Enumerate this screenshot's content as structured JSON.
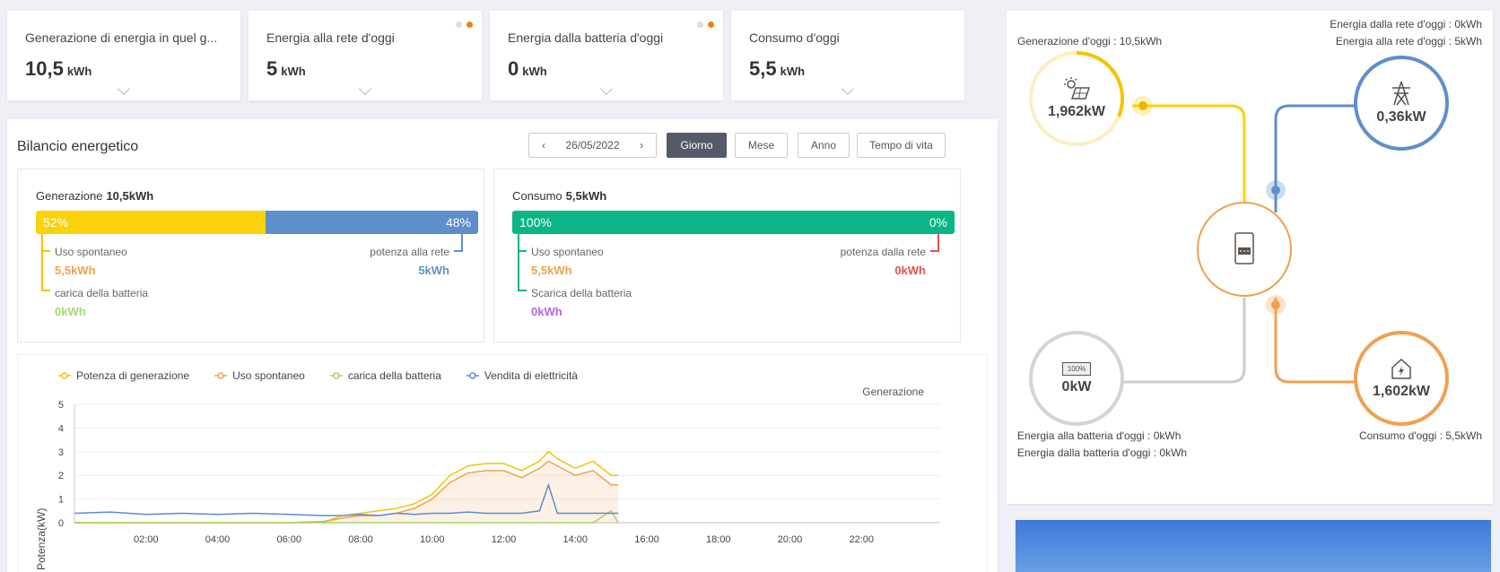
{
  "kpis": [
    {
      "title": "Generazione di energia in quel g...",
      "value": "10,5",
      "unit": "kWh",
      "dots": false
    },
    {
      "title": "Energia alla rete d'oggi",
      "value": "5",
      "unit": "kWh",
      "dots": true
    },
    {
      "title": "Energia dalla batteria d'oggi",
      "value": "0",
      "unit": "kWh",
      "dots": true
    },
    {
      "title": "Consumo d'oggi",
      "value": "5,5",
      "unit": "kWh",
      "dots": false
    }
  ],
  "balance": {
    "title": "Bilancio energetico",
    "date": "26/05/2022",
    "tabs": [
      "Giorno",
      "Mese",
      "Anno",
      "Tempo di vita"
    ],
    "generation": {
      "label": "Generazione",
      "total": "10,5kWh",
      "pct_left": "52%",
      "pct_right": "48%",
      "self_use_label": "Uso spontaneo",
      "self_use_value": "5,5kWh",
      "grid_label": "potenza alla rete",
      "grid_value": "5kWh",
      "battery_label": "carica della batteria",
      "battery_value": "0kWh"
    },
    "consumption": {
      "label": "Consumo",
      "total": "5,5kWh",
      "pct_left": "100%",
      "pct_right": "0%",
      "self_use_label": "Uso spontaneo",
      "self_use_value": "5,5kWh",
      "grid_label": "potenza dalla rete",
      "grid_value": "0kWh",
      "battery_label": "Scarica della batteria",
      "battery_value": "0kWh"
    }
  },
  "chart_data": {
    "type": "line",
    "title": "Generazione",
    "ylabel": "Potenza(kW)",
    "ylim": [
      0,
      5
    ],
    "yticks": [
      0,
      1,
      2,
      3,
      4,
      5
    ],
    "xticks": [
      "02:00",
      "04:00",
      "06:00",
      "08:00",
      "10:00",
      "12:00",
      "14:00",
      "16:00",
      "18:00",
      "20:00",
      "22:00"
    ],
    "x_hours": [
      0,
      1,
      2,
      3,
      4,
      5,
      6,
      7,
      7.5,
      8,
      8.5,
      9,
      9.5,
      10,
      10.5,
      11,
      11.5,
      12,
      12.5,
      13,
      13.25,
      13.5,
      14,
      14.5,
      15,
      15.2
    ],
    "series": [
      {
        "name": "Potenza di generazione",
        "color": "#f5c400",
        "values": [
          0,
          0,
          0,
          0,
          0,
          0,
          0,
          0.05,
          0.3,
          0.4,
          0.5,
          0.6,
          0.8,
          1.2,
          2.0,
          2.4,
          2.5,
          2.5,
          2.2,
          2.6,
          3.0,
          2.7,
          2.3,
          2.6,
          2.0,
          2.0
        ]
      },
      {
        "name": "Uso spontaneo",
        "color": "#f0a050",
        "values": [
          0,
          0,
          0,
          0,
          0,
          0,
          0,
          0.05,
          0.2,
          0.3,
          0.3,
          0.4,
          0.6,
          1.0,
          1.7,
          2.1,
          2.2,
          2.2,
          1.9,
          2.3,
          2.6,
          2.4,
          2.0,
          2.2,
          1.6,
          1.6
        ]
      },
      {
        "name": "carica della batteria",
        "color": "#a5d46a",
        "values": [
          0,
          0,
          0,
          0,
          0,
          0,
          0,
          0,
          0,
          0,
          0,
          0,
          0,
          0,
          0,
          0,
          0,
          0,
          0,
          0,
          0,
          0,
          0,
          0,
          0.5,
          0
        ]
      },
      {
        "name": "Vendita di elettricità",
        "color": "#5b8ed0",
        "values": [
          0.4,
          0.45,
          0.35,
          0.4,
          0.35,
          0.4,
          0.35,
          0.3,
          0.3,
          0.35,
          0.3,
          0.4,
          0.35,
          0.4,
          0.4,
          0.45,
          0.4,
          0.4,
          0.4,
          0.5,
          1.6,
          0.4,
          0.4,
          0.4,
          0.4,
          0.4
        ]
      }
    ]
  },
  "flow": {
    "generation_today_label": "Generazione d'oggi :",
    "generation_today_value": "10,5kWh",
    "grid_from_label": "Energia dalla rete d'oggi :",
    "grid_from_value": "0kWh",
    "grid_to_label": "Energia alla rete d'oggi :",
    "grid_to_value": "5kWh",
    "battery_to_label": "Energia alla batteria d'oggi :",
    "battery_to_value": "0kWh",
    "battery_from_label": "Energia dalla batteria d'oggi :",
    "battery_from_value": "0kWh",
    "consumption_label": "Consumo d'oggi :",
    "consumption_value": "5,5kWh",
    "solar_kw": "1,962kW",
    "grid_kw": "0,36kW",
    "battery_kw": "0kW",
    "battery_pct": "100%",
    "home_kw": "1,602kW"
  },
  "colors": {
    "yellow": "#fad20a",
    "blue": "#5e8fcb",
    "green": "#0bb585",
    "orange": "#f0a14f",
    "gray": "#cccccc",
    "red": "#e8504d",
    "lightgreen": "#a9d86e",
    "purple": "#b06ad8"
  }
}
